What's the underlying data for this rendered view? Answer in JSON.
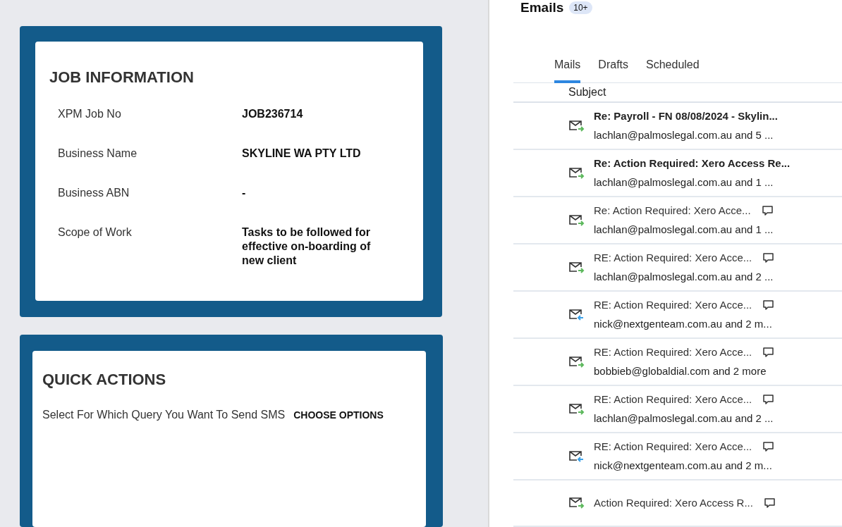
{
  "job_information": {
    "title": "JOB INFORMATION",
    "fields": [
      {
        "label": "XPM Job No",
        "value": "JOB236714"
      },
      {
        "label": "Business Name",
        "value": "SKYLINE WA PTY LTD"
      },
      {
        "label": "Business ABN",
        "value": "-"
      },
      {
        "label": "Scope of Work",
        "value": "Tasks to be followed for effective on-boarding of new client"
      }
    ]
  },
  "quick_actions": {
    "title": "QUICK ACTIONS",
    "prompt": "Select For Which Query You Want To Send SMS",
    "button": "CHOOSE OPTIONS"
  },
  "emails": {
    "title": "Emails",
    "count": "10+",
    "tabs": [
      {
        "label": "Mails",
        "selected": true
      },
      {
        "label": "Drafts",
        "selected": false
      },
      {
        "label": "Scheduled",
        "selected": false
      }
    ],
    "column": "Subject",
    "rows": [
      {
        "subject": "Re: Payroll - FN 08/08/2024 - Skylin...",
        "sender": "lachlan@palmoslegal.com.au and 5 ...",
        "unread": true,
        "kind": "sent",
        "has_comments": false
      },
      {
        "subject": "Re: Action Required: Xero Access Re...",
        "sender": "lachlan@palmoslegal.com.au and 1 ...",
        "unread": true,
        "kind": "sent",
        "has_comments": false
      },
      {
        "subject": "Re: Action Required: Xero Acce...",
        "sender": "lachlan@palmoslegal.com.au and 1 ...",
        "unread": false,
        "kind": "sent",
        "has_comments": true
      },
      {
        "subject": "RE: Action Required: Xero Acce...",
        "sender": "lachlan@palmoslegal.com.au and 2 ...",
        "unread": false,
        "kind": "sent",
        "has_comments": true
      },
      {
        "subject": "RE: Action Required: Xero Acce...",
        "sender": "nick@nextgenteam.com.au and 2 m...",
        "unread": false,
        "kind": "received",
        "has_comments": true
      },
      {
        "subject": "RE: Action Required: Xero Acce...",
        "sender": "bobbieb@globaldial.com and 2 more",
        "unread": false,
        "kind": "sent",
        "has_comments": true
      },
      {
        "subject": "RE: Action Required: Xero Acce...",
        "sender": "lachlan@palmoslegal.com.au and 2 ...",
        "unread": false,
        "kind": "sent",
        "has_comments": true
      },
      {
        "subject": "RE: Action Required: Xero Acce...",
        "sender": "nick@nextgenteam.com.au and 2 m...",
        "unread": false,
        "kind": "received",
        "has_comments": true
      },
      {
        "subject": "Action Required: Xero Access R...",
        "unread": false,
        "kind": "sent",
        "has_comments": true
      }
    ]
  }
}
